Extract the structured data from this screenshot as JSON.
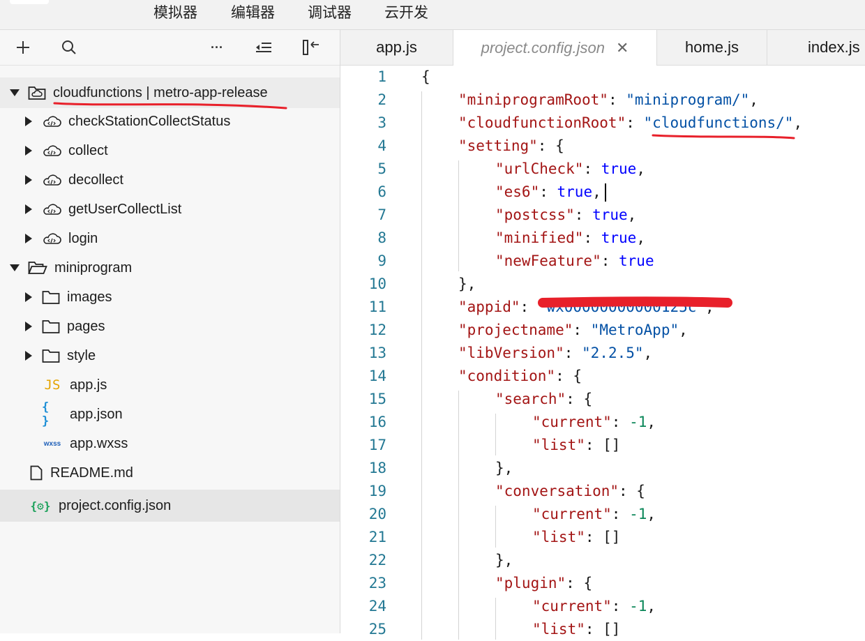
{
  "menubar": {
    "items": [
      "模拟器",
      "编辑器",
      "调试器",
      "云开发"
    ]
  },
  "sidebar": {
    "toolbar": {
      "add_icon": "plus-icon",
      "search_icon": "search-icon",
      "more_label": "···",
      "outline_icon": "indent-icon",
      "collapse_icon": "collapse-panel-icon"
    },
    "tree": [
      {
        "label": "cloudfunctions | metro-app-release",
        "icon": "cloud-folder-icon",
        "expanded": true,
        "level": 0
      },
      {
        "label": "checkStationCollectStatus",
        "icon": "cloud-function-icon",
        "expanded": false,
        "level": 1
      },
      {
        "label": "collect",
        "icon": "cloud-function-icon",
        "expanded": false,
        "level": 1
      },
      {
        "label": "decollect",
        "icon": "cloud-function-icon",
        "expanded": false,
        "level": 1
      },
      {
        "label": "getUserCollectList",
        "icon": "cloud-function-icon",
        "expanded": false,
        "level": 1
      },
      {
        "label": "login",
        "icon": "cloud-function-icon",
        "expanded": false,
        "level": 1
      },
      {
        "label": "miniprogram",
        "icon": "folder-open-icon",
        "expanded": true,
        "level": 0
      },
      {
        "label": "images",
        "icon": "folder-icon",
        "expanded": false,
        "level": 1
      },
      {
        "label": "pages",
        "icon": "folder-icon",
        "expanded": false,
        "level": 1
      },
      {
        "label": "style",
        "icon": "folder-icon",
        "expanded": false,
        "level": 1
      },
      {
        "label": "app.js",
        "icon": "js-file-icon",
        "icon_text": "JS",
        "level": 1
      },
      {
        "label": "app.json",
        "icon": "json-file-icon",
        "icon_text": "{ }",
        "level": 1
      },
      {
        "label": "app.wxss",
        "icon": "wxss-file-icon",
        "icon_text": "wxss",
        "level": 1
      },
      {
        "label": "README.md",
        "icon": "file-icon",
        "level": 0
      },
      {
        "label": "project.config.json",
        "icon": "config-file-icon",
        "icon_text": "{⚙}",
        "level": 0,
        "selected": true
      }
    ]
  },
  "tabs": [
    {
      "label": "app.js",
      "active": false
    },
    {
      "label": "project.config.json",
      "active": true,
      "close": "✕"
    },
    {
      "label": "home.js",
      "active": false
    },
    {
      "label": "index.js",
      "active": false
    }
  ],
  "editor": {
    "lines": [
      {
        "n": "1",
        "indent": 0,
        "t": [
          [
            "p",
            "{"
          ]
        ]
      },
      {
        "n": "2",
        "indent": 1,
        "t": [
          [
            "k",
            "\"miniprogramRoot\""
          ],
          [
            "p",
            ": "
          ],
          [
            "s",
            "\"miniprogram/\""
          ],
          [
            "p",
            ","
          ]
        ]
      },
      {
        "n": "3",
        "indent": 1,
        "t": [
          [
            "k",
            "\"cloudfunctionRoot\""
          ],
          [
            "p",
            ": "
          ],
          [
            "s",
            "\"cloudfunctions/\""
          ],
          [
            "p",
            ","
          ]
        ]
      },
      {
        "n": "4",
        "indent": 1,
        "t": [
          [
            "k",
            "\"setting\""
          ],
          [
            "p",
            ": {"
          ]
        ]
      },
      {
        "n": "5",
        "indent": 2,
        "t": [
          [
            "k",
            "\"urlCheck\""
          ],
          [
            "p",
            ": "
          ],
          [
            "b",
            "true"
          ],
          [
            "p",
            ","
          ]
        ]
      },
      {
        "n": "6",
        "indent": 2,
        "t": [
          [
            "k",
            "\"es6\""
          ],
          [
            "p",
            ": "
          ],
          [
            "b",
            "true"
          ],
          [
            "p",
            ","
          ]
        ]
      },
      {
        "n": "7",
        "indent": 2,
        "t": [
          [
            "k",
            "\"postcss\""
          ],
          [
            "p",
            ": "
          ],
          [
            "b",
            "true"
          ],
          [
            "p",
            ","
          ]
        ]
      },
      {
        "n": "8",
        "indent": 2,
        "t": [
          [
            "k",
            "\"minified\""
          ],
          [
            "p",
            ": "
          ],
          [
            "b",
            "true"
          ],
          [
            "p",
            ","
          ]
        ]
      },
      {
        "n": "9",
        "indent": 2,
        "t": [
          [
            "k",
            "\"newFeature\""
          ],
          [
            "p",
            ": "
          ],
          [
            "b",
            "true"
          ]
        ]
      },
      {
        "n": "10",
        "indent": 1,
        "t": [
          [
            "p",
            "},"
          ]
        ]
      },
      {
        "n": "11",
        "indent": 1,
        "t": [
          [
            "k",
            "\"appid\""
          ],
          [
            "p",
            ": "
          ],
          [
            "s",
            "\"wx00000000000125c\""
          ],
          [
            "p",
            ","
          ]
        ]
      },
      {
        "n": "12",
        "indent": 1,
        "t": [
          [
            "k",
            "\"projectname\""
          ],
          [
            "p",
            ": "
          ],
          [
            "s",
            "\"MetroApp\""
          ],
          [
            "p",
            ","
          ]
        ]
      },
      {
        "n": "13",
        "indent": 1,
        "t": [
          [
            "k",
            "\"libVersion\""
          ],
          [
            "p",
            ": "
          ],
          [
            "s",
            "\"2.2.5\""
          ],
          [
            "p",
            ","
          ]
        ]
      },
      {
        "n": "14",
        "indent": 1,
        "t": [
          [
            "k",
            "\"condition\""
          ],
          [
            "p",
            ": {"
          ]
        ]
      },
      {
        "n": "15",
        "indent": 2,
        "t": [
          [
            "k",
            "\"search\""
          ],
          [
            "p",
            ": {"
          ]
        ]
      },
      {
        "n": "16",
        "indent": 3,
        "t": [
          [
            "k",
            "\"current\""
          ],
          [
            "p",
            ": "
          ],
          [
            "n",
            "-1"
          ],
          [
            "p",
            ","
          ]
        ]
      },
      {
        "n": "17",
        "indent": 3,
        "t": [
          [
            "k",
            "\"list\""
          ],
          [
            "p",
            ": []"
          ]
        ]
      },
      {
        "n": "18",
        "indent": 2,
        "t": [
          [
            "p",
            "},"
          ]
        ]
      },
      {
        "n": "19",
        "indent": 2,
        "t": [
          [
            "k",
            "\"conversation\""
          ],
          [
            "p",
            ": {"
          ]
        ]
      },
      {
        "n": "20",
        "indent": 3,
        "t": [
          [
            "k",
            "\"current\""
          ],
          [
            "p",
            ": "
          ],
          [
            "n",
            "-1"
          ],
          [
            "p",
            ","
          ]
        ]
      },
      {
        "n": "21",
        "indent": 3,
        "t": [
          [
            "k",
            "\"list\""
          ],
          [
            "p",
            ": []"
          ]
        ]
      },
      {
        "n": "22",
        "indent": 2,
        "t": [
          [
            "p",
            "},"
          ]
        ]
      },
      {
        "n": "23",
        "indent": 2,
        "t": [
          [
            "k",
            "\"plugin\""
          ],
          [
            "p",
            ": {"
          ]
        ]
      },
      {
        "n": "24",
        "indent": 3,
        "t": [
          [
            "k",
            "\"current\""
          ],
          [
            "p",
            ": "
          ],
          [
            "n",
            "-1"
          ],
          [
            "p",
            ","
          ]
        ]
      },
      {
        "n": "25",
        "indent": 3,
        "t": [
          [
            "k",
            "\"list\""
          ],
          [
            "p",
            ": []"
          ]
        ]
      }
    ]
  },
  "colors": {
    "annotation_red": "#e8202a",
    "line_number": "#237893",
    "json_key": "#a31515",
    "json_string": "#0451a5",
    "json_bool": "#0000ff",
    "json_number": "#098658",
    "js_icon": "#e5a400",
    "json_icon": "#1e8fd6",
    "config_icon": "#18a058"
  }
}
